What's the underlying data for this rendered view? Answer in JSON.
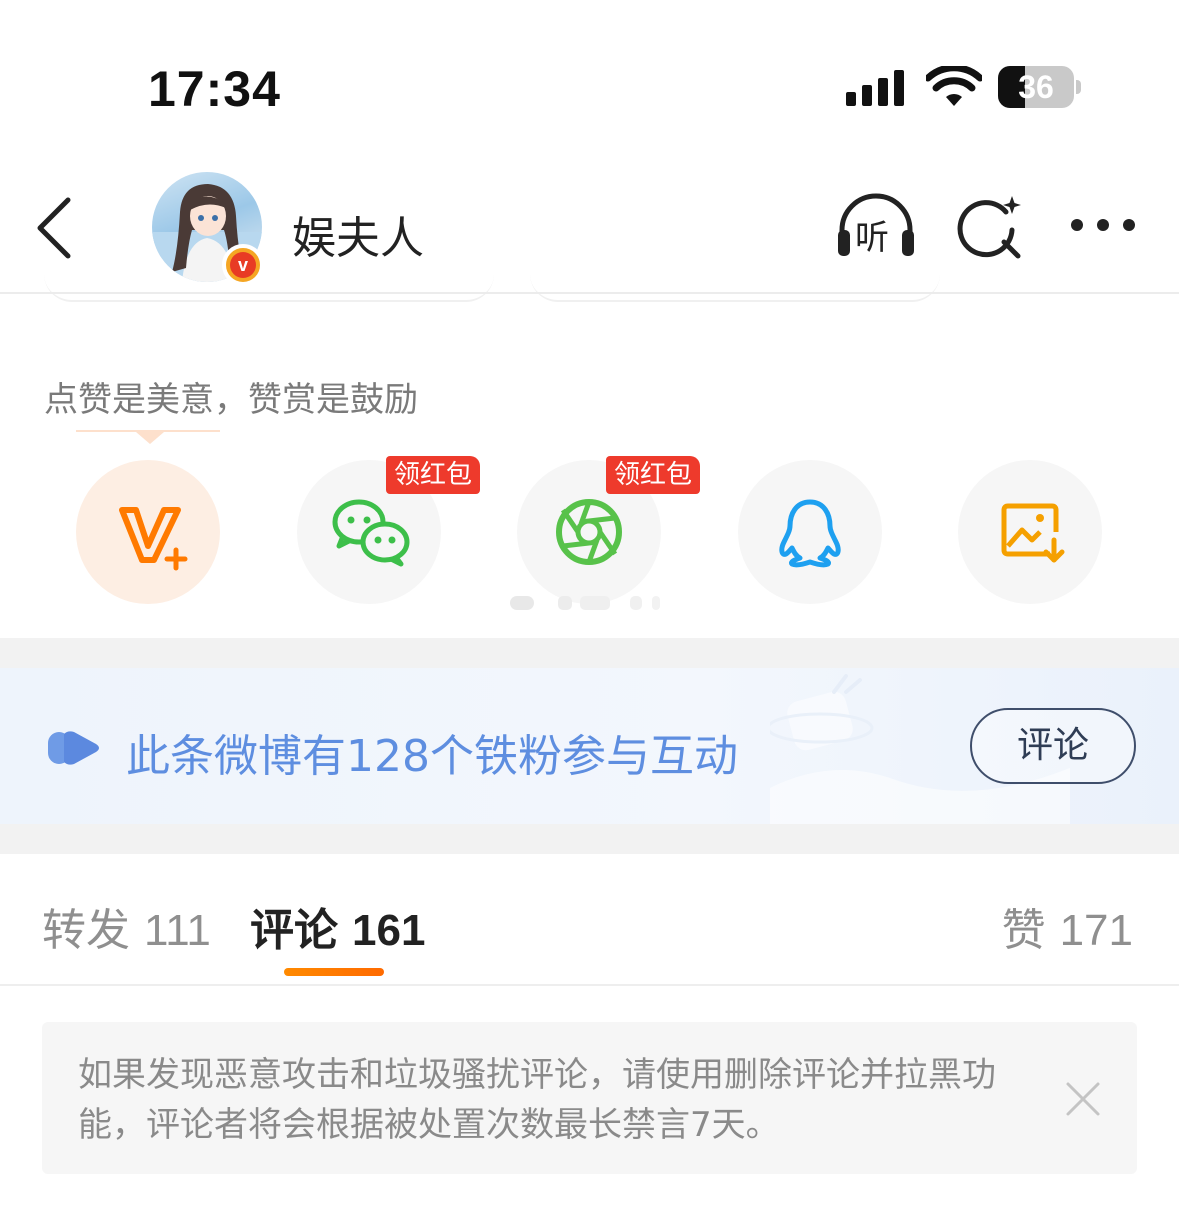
{
  "status_bar": {
    "time": "17:34",
    "battery": "36",
    "battery_level": 0.36,
    "icons": [
      "signal-icon",
      "wifi-icon",
      "battery-icon"
    ]
  },
  "nav": {
    "title": "娱夫人",
    "listen_label": "听",
    "icons": [
      "back-icon",
      "headphones-icon",
      "ai-search-icon",
      "more-icon"
    ]
  },
  "reward": {
    "title": "点赞是美意，赞赏是鼓励"
  },
  "share": {
    "items": [
      {
        "icon": "v-plus-icon",
        "badge": ""
      },
      {
        "icon": "wechat-icon",
        "badge": "领红包"
      },
      {
        "icon": "moments-icon",
        "badge": "领红包"
      },
      {
        "icon": "qq-icon",
        "badge": ""
      },
      {
        "icon": "save-image-icon",
        "badge": ""
      }
    ]
  },
  "fans": {
    "text": "此条微博有128个铁粉参与互动",
    "button": "评论"
  },
  "tabs": {
    "repost_label": "转发",
    "repost_count": "111",
    "comment_label": "评论",
    "comment_count": "161",
    "like_label": "赞",
    "like_count": "171",
    "active": "comment"
  },
  "notice": {
    "text": "如果发现恶意攻击和垃圾骚扰评论，请使用删除评论并拉黑功能，评论者将会根据被处置次数最长禁言7天。"
  },
  "colors": {
    "accent_orange": "#ff7a00",
    "badge_red": "#ee3a2c",
    "fans_blue": "#5e8ee0",
    "wechat_green": "#3dbf4a",
    "qq_blue": "#1ea0f0"
  }
}
